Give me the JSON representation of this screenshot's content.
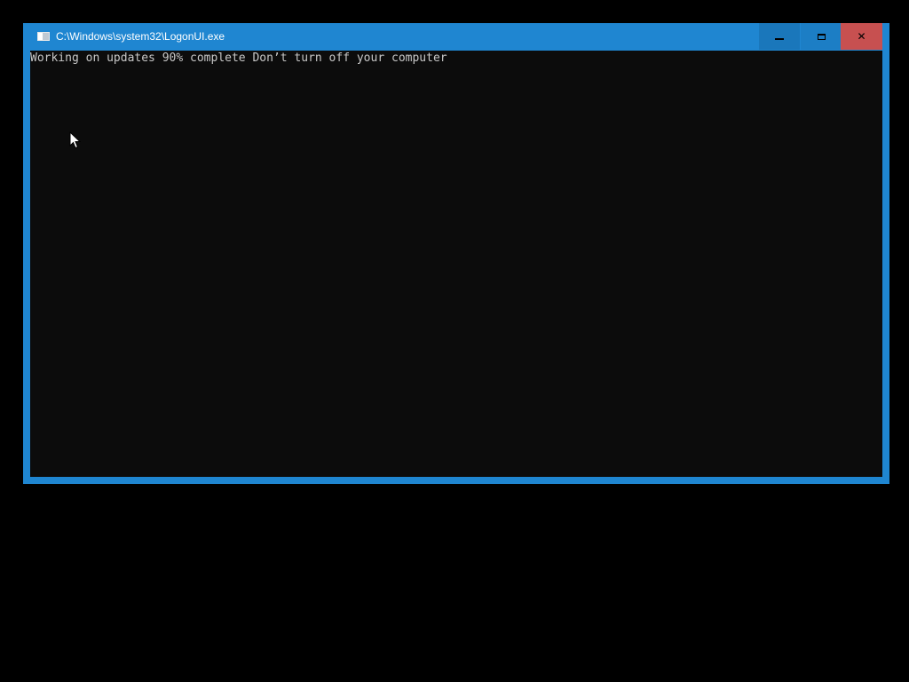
{
  "window": {
    "title": "C:\\Windows\\system32\\LogonUI.exe",
    "icon": "console-window-icon",
    "buttons": {
      "minimize": "minimize-icon",
      "maximize": "maximize-icon",
      "close_label": "✕"
    }
  },
  "console": {
    "line": "Working on updates 90% complete Don’t turn off your computer",
    "progress_percent": 90
  },
  "colors": {
    "accent": "#1f86d1",
    "console_bg": "#0c0c0c",
    "console_text": "#c8c8c8",
    "close_hover": "#c75050",
    "desktop": "#000000"
  }
}
